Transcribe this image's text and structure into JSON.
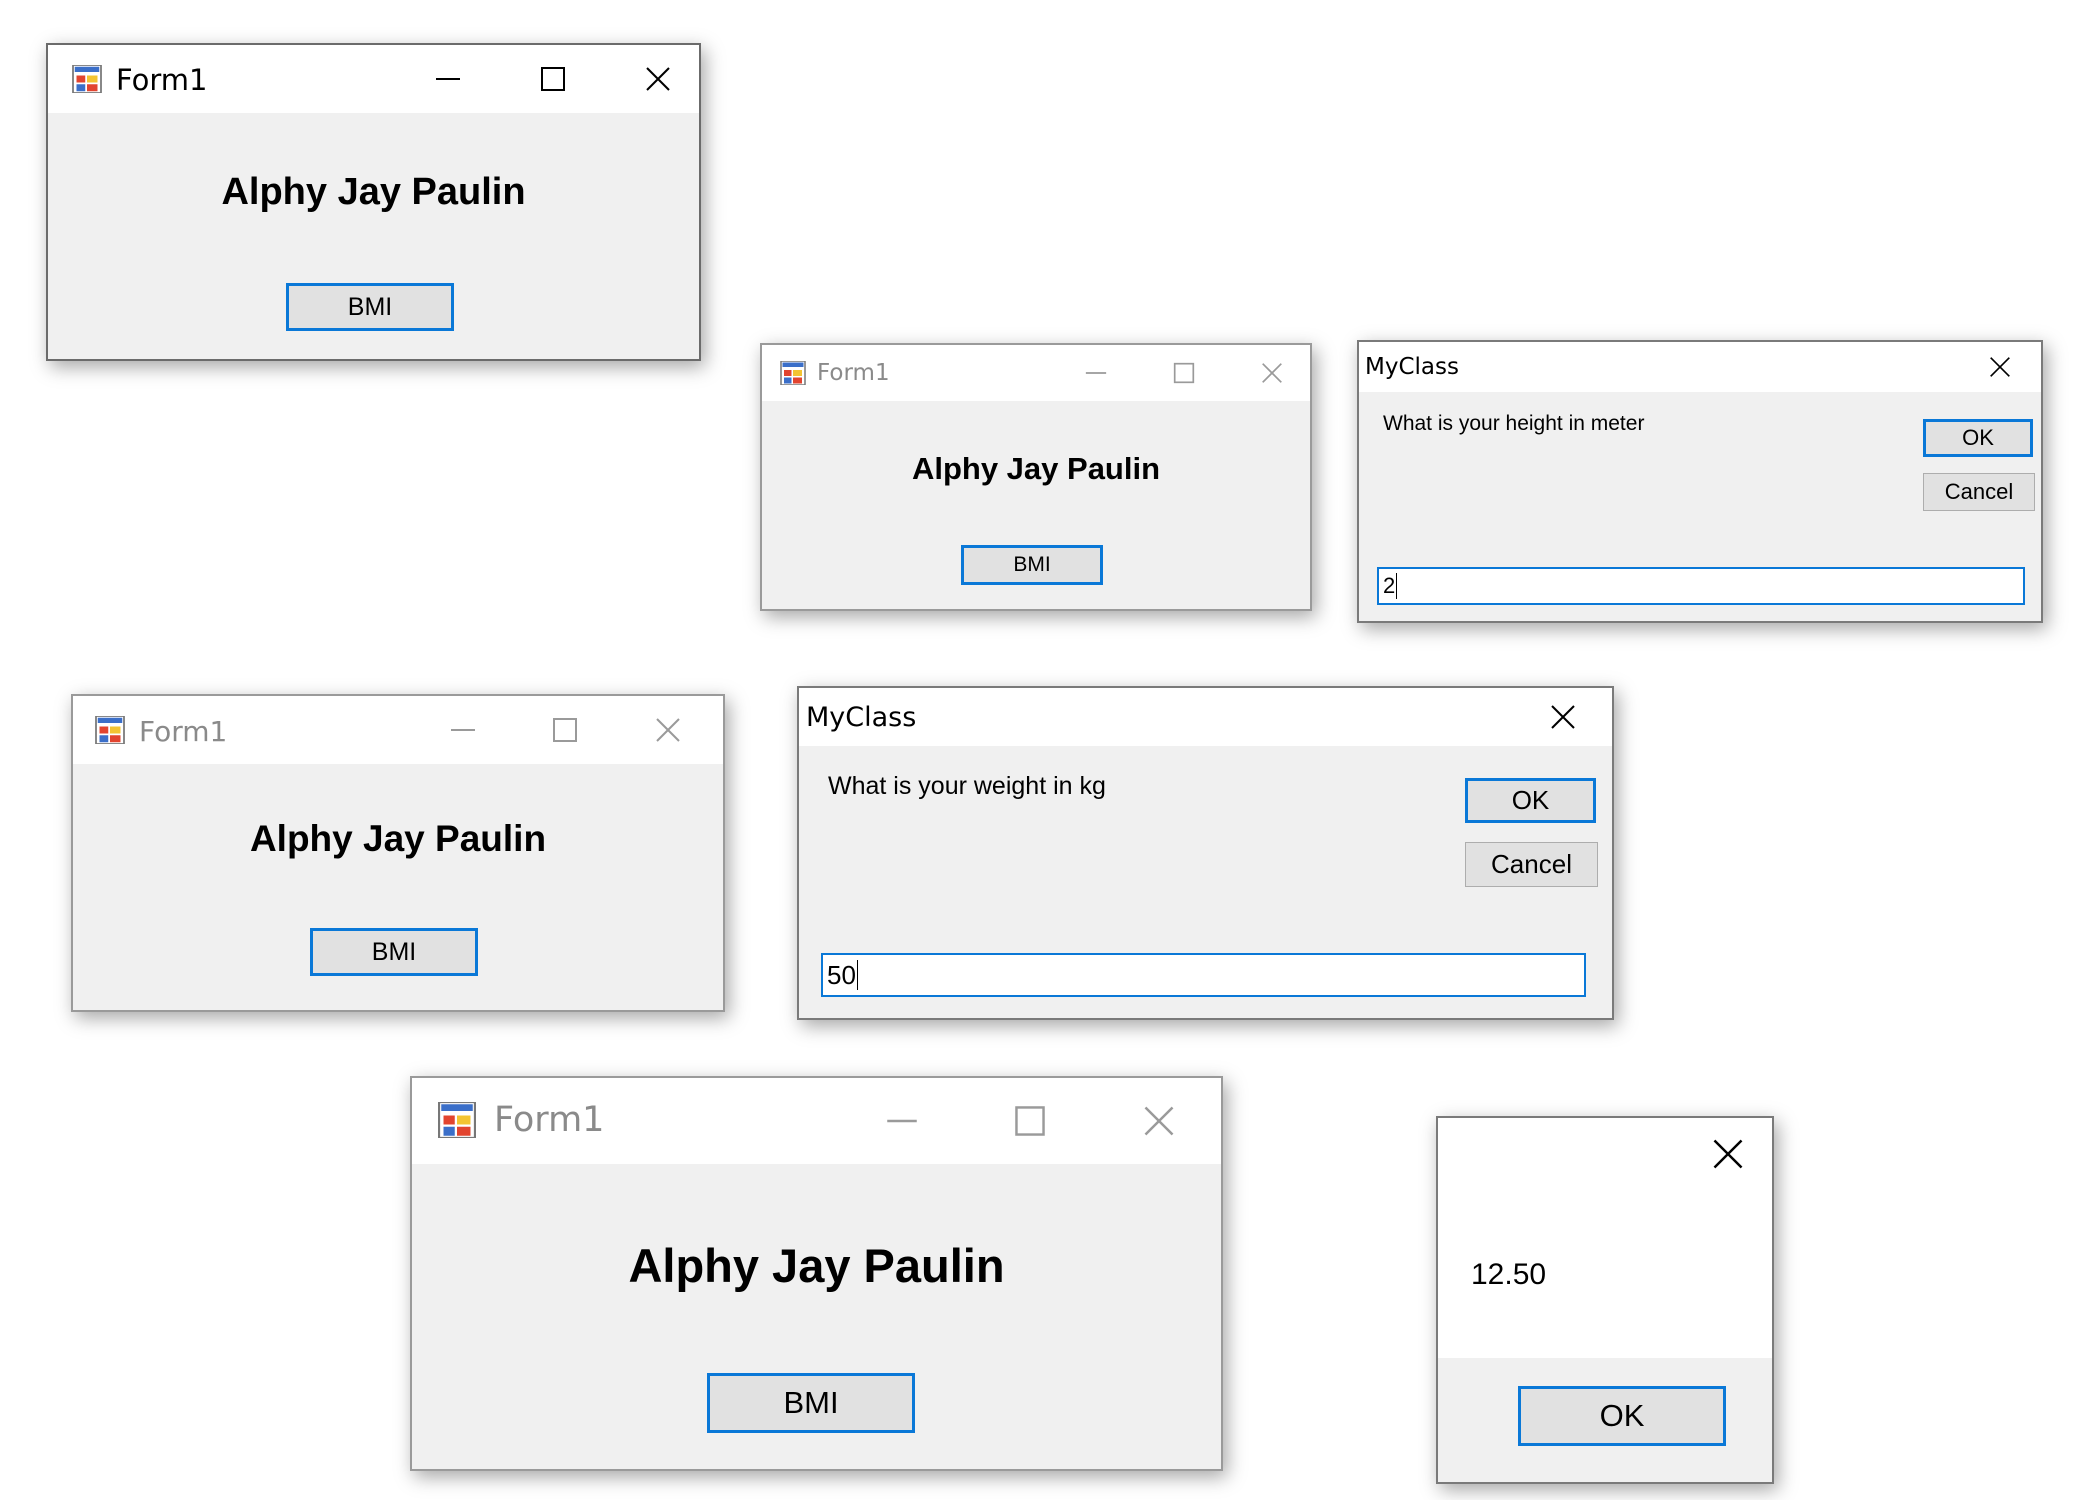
{
  "form_window": {
    "title": "Form1",
    "heading": "Alphy Jay Paulin",
    "bmi_button_label": "BMI",
    "minimize_glyph": "minimize-icon",
    "maximize_glyph": "maximize-icon",
    "close_glyph": "close-icon"
  },
  "height_prompt": {
    "title": "MyClass",
    "question": "What is your height in meter",
    "ok_label": "OK",
    "cancel_label": "Cancel",
    "input_value": "2"
  },
  "weight_prompt": {
    "title": "MyClass",
    "question": "What is your weight in kg",
    "ok_label": "OK",
    "cancel_label": "Cancel",
    "input_value": "50"
  },
  "result_box": {
    "message": "12.50",
    "ok_label": "OK"
  },
  "colors": {
    "window_bg": "#f0f0f0",
    "title_bg": "#ffffff",
    "accent": "#0a78d7",
    "button_bg": "#e1e1e1"
  }
}
